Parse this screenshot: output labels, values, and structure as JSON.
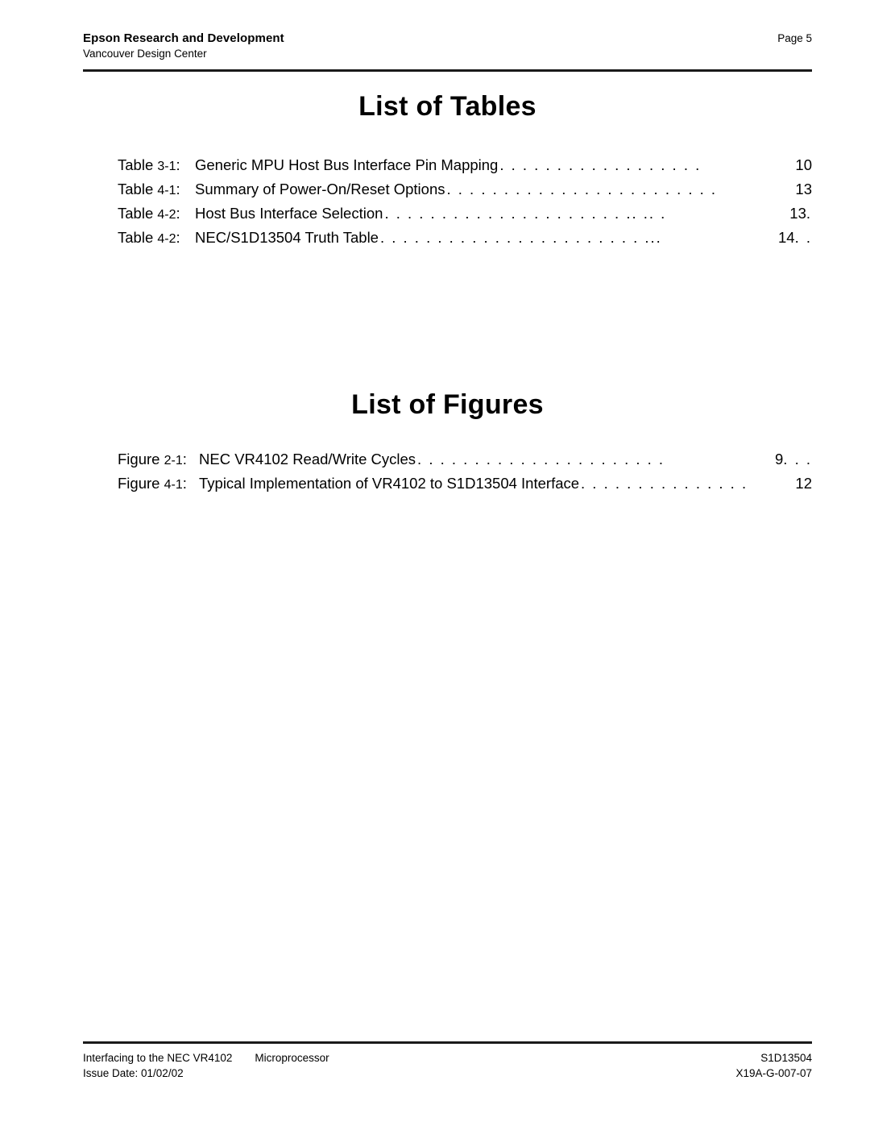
{
  "header": {
    "title": "Epson Research and Development",
    "subtitle": "Vancouver Design Center",
    "page_label": "Page 5"
  },
  "sections": {
    "tables": {
      "heading": "List of Tables",
      "entries": [
        {
          "kind": "Table",
          "number": "3-1",
          "separator": ":",
          "title": "Generic MPU Host Bus Interface Pin Mapping",
          "leader": ". . . . . . . . . . . . . . . . . .",
          "page": "10",
          "trailing": ""
        },
        {
          "kind": "Table",
          "number": "4-1",
          "separator": ":",
          "title": "Summary of Power-On/Reset Options",
          "leader": ". . . . . . . . . . . . . . . . . . . . . . . .",
          "page": "13",
          "trailing": ""
        },
        {
          "kind": "Table",
          "number": "4-2",
          "separator": ":",
          "title": "Host Bus Interface Selection",
          "leader": ". . . . . . . . . . . . . . . . . . . . . .. .. .",
          "page": "13",
          "trailing": " ."
        },
        {
          "kind": "Table",
          "number": "4-2",
          "separator": ":",
          "title": "NEC/S1D13504 Truth Table",
          "leader": ". . . . . . . . . . . . . . . . . . . . . . . ...",
          "page": "14",
          "trailing": ". ."
        }
      ]
    },
    "figures": {
      "heading": "List of Figures",
      "entries": [
        {
          "kind": "Figure",
          "number": "2-1",
          "separator": ":",
          "title": "NEC VR4102 Read/Write Cycles",
          "leader": ". . . . . . . . . . . . . . . . . . . . . .",
          "page": "9",
          "trailing": " . . ."
        },
        {
          "kind": "Figure",
          "number": "4-1",
          "separator": ":",
          "title": "Typical Implementation of VR4102 to S1D13504 Interface",
          "leader": ". . . . . . . . . . . . . . .",
          "page": "12",
          "trailing": ""
        }
      ]
    }
  },
  "footer": {
    "left_line1_a": "Interfacing to the NEC VR4102",
    "left_line1_b": "Microprocessor",
    "left_line2": "Issue Date: 01/02/02",
    "right_line1": "S1D13504",
    "right_line2": "X19A-G-007-07"
  }
}
